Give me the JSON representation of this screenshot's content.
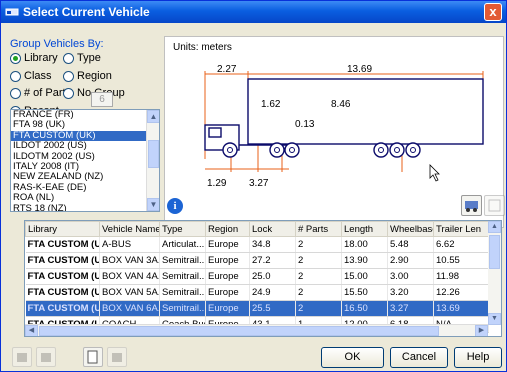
{
  "window": {
    "title": "Select Current Vehicle",
    "close_glyph": "x"
  },
  "group": {
    "label": "Group Vehicles By:",
    "options": [
      {
        "label": "Library",
        "selected": true
      },
      {
        "label": "Type",
        "selected": false
      },
      {
        "label": "Class",
        "selected": false
      },
      {
        "label": "Region",
        "selected": false
      },
      {
        "label": "# of Parts",
        "selected": false
      },
      {
        "label": "No Group",
        "selected": false
      },
      {
        "label": "Recent",
        "selected": false
      }
    ],
    "recent_count": "6"
  },
  "library_list": {
    "items": [
      "FRANCE (FR)",
      "FTA 98 (UK)",
      "FTA CUSTOM (UK)",
      "ILDOT 2002 (US)",
      "ILDOTM 2002 (US)",
      "ITALY 2008 (IT)",
      "NEW ZEALAND (NZ)",
      "RAS-K-EAE (DE)",
      "ROA (NL)",
      "RTS 18 (NZ)"
    ],
    "selected_index": 2
  },
  "diagram": {
    "units": "Units:  meters",
    "dims": {
      "cab_length": "2.27",
      "trailer_length": "13.69",
      "coupling_offset": "1.62",
      "trailer_wheelbase": "8.46",
      "kingpin": "0.13",
      "front_overhang": "1.29",
      "tractor_wheelbase": "3.27"
    }
  },
  "table": {
    "headers": [
      "Library",
      "Vehicle Name",
      "Type",
      "Region",
      "Lock",
      "# Parts",
      "Length",
      "Wheelbase",
      "Trailer Len"
    ],
    "rows": [
      [
        "FTA CUSTOM (UK)",
        "A-BUS",
        "Articulat...",
        "Europe",
        "34.8",
        "2",
        "18.00",
        "5.48",
        "6.62"
      ],
      [
        "FTA CUSTOM (UK)",
        "BOX VAN 3A...",
        "Semitrail...",
        "Europe",
        "27.2",
        "2",
        "13.90",
        "2.90",
        "10.55"
      ],
      [
        "FTA CUSTOM (UK)",
        "BOX VAN 4A...",
        "Semitrail...",
        "Europe",
        "25.0",
        "2",
        "15.00",
        "3.00",
        "11.98"
      ],
      [
        "FTA CUSTOM (UK)",
        "BOX VAN 5A...",
        "Semitrail...",
        "Europe",
        "24.9",
        "2",
        "15.50",
        "3.20",
        "12.26"
      ],
      [
        "FTA CUSTOM (UK)",
        "BOX VAN 6A...",
        "Semitrail...",
        "Europe",
        "25.5",
        "2",
        "16.50",
        "3.27",
        "13.69"
      ],
      [
        "FTA CUSTOM (UK)",
        "COACH",
        "Coach Bus",
        "Europe",
        "43.1",
        "1",
        "12.00",
        "6.18",
        "N/A"
      ]
    ],
    "selected_row": 4
  },
  "buttons": {
    "ok": "OK",
    "cancel": "Cancel",
    "help": "Help"
  },
  "colors": {
    "titlebar": "#0a5ee0",
    "selection": "#316ac5",
    "dimension_lines": "#e8621a"
  }
}
